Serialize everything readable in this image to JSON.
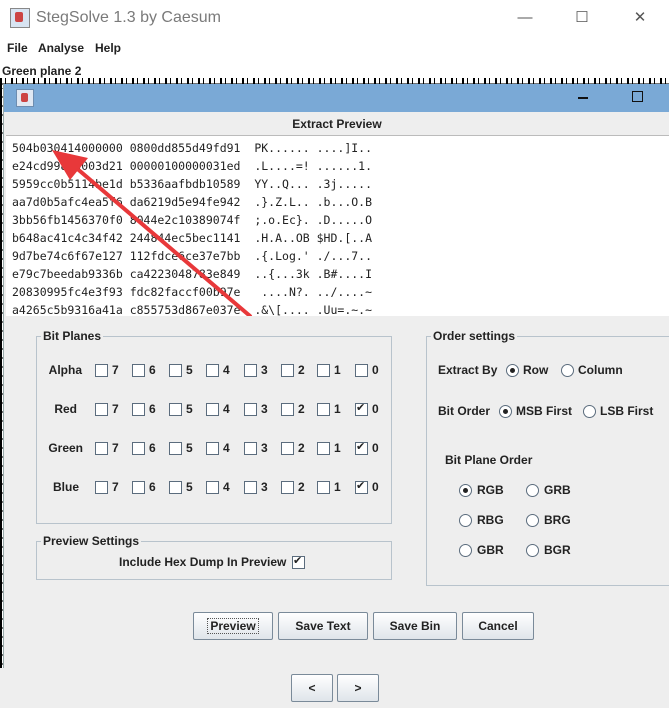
{
  "window": {
    "title": "StegSolve 1.3 by Caesum",
    "minimize": "—",
    "maximize": "☐",
    "close": "✕"
  },
  "menu": [
    "File",
    "Analyse",
    "Help"
  ],
  "plane_label": "Green plane 2",
  "dialog": {
    "preview_title": "Extract Preview",
    "hex_lines": [
      "504b030414000000 0800dd855d49fd91  PK...... ....]I..",
      "e24cd99800003d21 00000100000031ed  .L....=! ......1.",
      "5959cc0b5114be1d b5336aafbdb10589  YY..Q... .3j.....",
      "aa7d0b5afc4ea5f6 da6219d5e94fe942  .}.Z.L.. .b...O.B",
      "3bb56fb1456370f0 8044e2c10389074f  ;.o.Ec}. .D.....O",
      "b648ac41c4c34f42 244844ec5bec1141  .H.A..OB $HD.[..A",
      "9d7be74c6f67e127 112fdce6ce37e7bb  .{.Log.' ./...7..",
      "e79c7beedab9336b ca4223048783e849  ..{...3k .B#....I",
      "20830995fc4e3f93 fdc82faccf00b97e   ....N?. ../....~",
      "a4265c5b9316a41a c855753d867e037e  .&\\[.... .Uu=.~.~"
    ],
    "bit_planes": {
      "title": "Bit Planes",
      "bits": [
        "7",
        "6",
        "5",
        "4",
        "3",
        "2",
        "1",
        "0"
      ],
      "rows": [
        {
          "label": "Alpha",
          "checked": []
        },
        {
          "label": "Red",
          "checked": [
            "0"
          ]
        },
        {
          "label": "Green",
          "checked": [
            "0"
          ]
        },
        {
          "label": "Blue",
          "checked": [
            "0"
          ]
        }
      ]
    },
    "preview_settings": {
      "title": "Preview Settings",
      "hex_dump_label": "Include Hex Dump In Preview",
      "hex_dump_checked": true
    },
    "order_settings": {
      "title": "Order settings",
      "extract_by_label": "Extract By",
      "extract_by_options": [
        "Row",
        "Column"
      ],
      "extract_by_selected": "Row",
      "bit_order_label": "Bit Order",
      "bit_order_options": [
        "MSB First",
        "LSB First"
      ],
      "bit_order_selected": "MSB First",
      "bit_plane_order_label": "Bit Plane Order",
      "bit_plane_order_options": [
        "RGB",
        "GRB",
        "RBG",
        "BRG",
        "GBR",
        "BGR"
      ],
      "bit_plane_order_selected": "RGB"
    },
    "buttons": {
      "preview": "Preview",
      "save_text": "Save Text",
      "save_bin": "Save Bin",
      "cancel": "Cancel"
    }
  },
  "nav": {
    "prev": "<",
    "next": ">"
  },
  "colors": {
    "dialog_titlebar": "#7aa9d6",
    "annotation_arrow": "#e8383a"
  }
}
